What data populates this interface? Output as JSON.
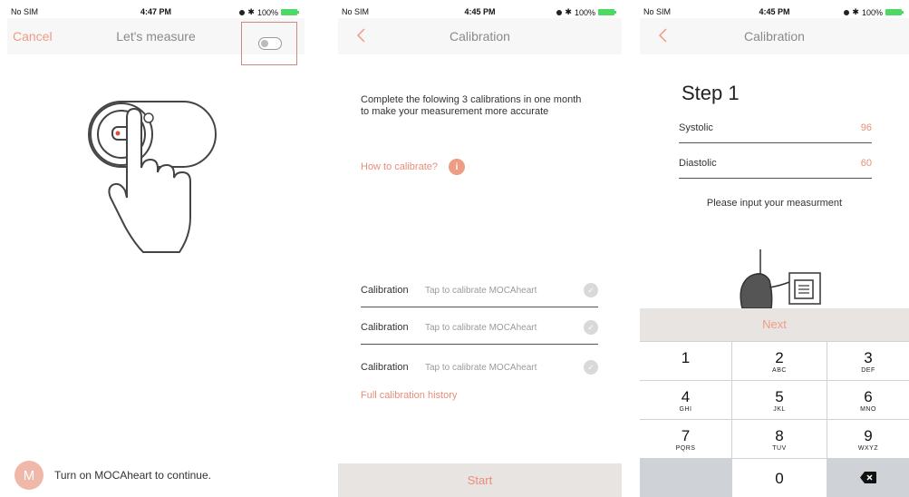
{
  "screen1": {
    "status": {
      "carrier": "No SIM",
      "time": "4:47 PM",
      "battery": "100%"
    },
    "nav": {
      "cancel_label": "Cancel",
      "title": "Let's measure"
    },
    "footer": {
      "avatar_letter": "M",
      "message": "Turn on MOCAheart to continue."
    }
  },
  "screen2": {
    "status": {
      "carrier": "No SIM",
      "time": "4:45 PM",
      "battery": "100%"
    },
    "nav": {
      "title": "Calibration"
    },
    "intro": "Complete the folowing 3 calibrations in one month to make your measurement more accurate",
    "how_to": {
      "label": "How to calibrate?",
      "icon_glyph": "i"
    },
    "calibrations": [
      {
        "label": "Calibration",
        "hint": "Tap to calibrate MOCAheart"
      },
      {
        "label": "Calibration",
        "hint": "Tap to calibrate MOCAheart"
      },
      {
        "label": "Calibration",
        "hint": "Tap to calibrate MOCAheart"
      }
    ],
    "history_label": "Full calibration history",
    "start_label": "Start"
  },
  "screen3": {
    "status": {
      "carrier": "No SIM",
      "time": "4:45 PM",
      "battery": "100%"
    },
    "nav": {
      "title": "Calibration"
    },
    "step_title": "Step 1",
    "fields": [
      {
        "label": "Systolic",
        "value": "96"
      },
      {
        "label": "Diastolic",
        "value": "60"
      }
    ],
    "prompt": "Please input your measurment",
    "next_label": "Next",
    "keypad": [
      {
        "num": "1",
        "letters": ""
      },
      {
        "num": "2",
        "letters": "ABC"
      },
      {
        "num": "3",
        "letters": "DEF"
      },
      {
        "num": "4",
        "letters": "GHI"
      },
      {
        "num": "5",
        "letters": "JKL"
      },
      {
        "num": "6",
        "letters": "MNO"
      },
      {
        "num": "7",
        "letters": "PQRS"
      },
      {
        "num": "8",
        "letters": "TUV"
      },
      {
        "num": "9",
        "letters": "WXYZ"
      },
      {
        "num": "0",
        "letters": ""
      }
    ]
  },
  "colors": {
    "accent": "#ef9c84",
    "accent_text": "#ea8d78",
    "bar_bg": "#e8e4e2",
    "keypad_bg": "#cfd3d8",
    "battery": "#4cd964"
  }
}
